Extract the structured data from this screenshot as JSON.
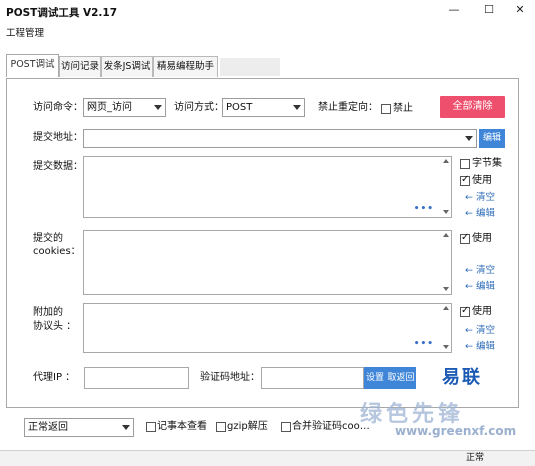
{
  "window": {
    "title": "POST调试工具 V2.17",
    "minimize": "—",
    "maximize": "☐",
    "close": "✕"
  },
  "menu": {
    "item": "工程管理"
  },
  "tabs": [
    {
      "label": "POST调试"
    },
    {
      "label": "访问记录"
    },
    {
      "label": "发条JS调试"
    },
    {
      "label": "精易编程助手"
    }
  ],
  "form": {
    "access_cmd_label": "访问命令：",
    "access_cmd_value": "网页_访问",
    "access_method_label": "访问方式：",
    "access_method_value": "POST",
    "no_redirect_label": "禁止重定向：",
    "no_redirect_check_label": "禁止",
    "clear_all": "全部清除",
    "submit_url_label": "提交地址：",
    "submit_url_value": "",
    "edit_btn": "编辑",
    "submit_data_label": "提交数据：",
    "byteset_label": "字节集",
    "use_label": "使用",
    "clear_link": "← 清空",
    "edit_link": "← 编辑",
    "cookies_label_1": "提交的",
    "cookies_label_2": "cookies：",
    "headers_label_1": "附加的",
    "headers_label_2": "协议头 ：",
    "ellipsis": "•••",
    "proxy_label": "代理IP ：",
    "proxy_value": "",
    "captcha_label": "验证码地址：",
    "captcha_value": "",
    "set_btn": "设置",
    "fetch_btn": "取返回",
    "logo_text": "易联"
  },
  "bottom": {
    "return_mode": "正常返回",
    "notepad_label": "记事本查看",
    "gzip_label": "gzip解压",
    "merge_label": "合并验证码coo…"
  },
  "status": {
    "text": "正常"
  },
  "watermark": {
    "text": "绿色先锋",
    "url": "www.greenxf.com"
  }
}
